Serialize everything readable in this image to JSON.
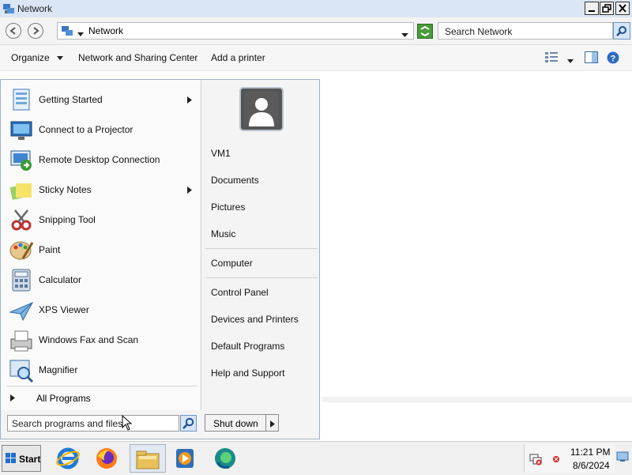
{
  "window": {
    "title": "Network"
  },
  "address_bar": {
    "location": "Network",
    "search_placeholder": "Search Network"
  },
  "toolbar": {
    "organize": "Organize",
    "network_sharing_center": "Network and Sharing Center",
    "add_printer": "Add a printer"
  },
  "start_menu": {
    "programs": [
      {
        "label": "Getting Started",
        "icon": "getting-started-icon",
        "has_submenu": true
      },
      {
        "label": "Connect to a Projector",
        "icon": "projector-icon",
        "has_submenu": false
      },
      {
        "label": "Remote Desktop Connection",
        "icon": "remote-desktop-icon",
        "has_submenu": false
      },
      {
        "label": "Sticky Notes",
        "icon": "sticky-notes-icon",
        "has_submenu": true
      },
      {
        "label": "Snipping Tool",
        "icon": "snipping-tool-icon",
        "has_submenu": false
      },
      {
        "label": "Paint",
        "icon": "paint-icon",
        "has_submenu": false
      },
      {
        "label": "Calculator",
        "icon": "calculator-icon",
        "has_submenu": false
      },
      {
        "label": "XPS Viewer",
        "icon": "xps-viewer-icon",
        "has_submenu": false
      },
      {
        "label": "Windows Fax and Scan",
        "icon": "fax-scan-icon",
        "has_submenu": false
      },
      {
        "label": "Magnifier",
        "icon": "magnifier-icon",
        "has_submenu": false
      }
    ],
    "all_programs": "All Programs",
    "search_value": "Search programs and files",
    "right_items": {
      "user": "VM1",
      "documents": "Documents",
      "pictures": "Pictures",
      "music": "Music",
      "computer": "Computer",
      "control_panel": "Control Panel",
      "devices_printers": "Devices and Printers",
      "default_programs": "Default Programs",
      "help_support": "Help and Support"
    },
    "shutdown": "Shut down"
  },
  "taskbar": {
    "start": "Start",
    "time": "11:21 PM",
    "date": "8/6/2024",
    "pinned": [
      "internet-explorer-icon",
      "firefox-icon",
      "file-explorer-icon",
      "media-player-icon",
      "edge-icon"
    ]
  }
}
